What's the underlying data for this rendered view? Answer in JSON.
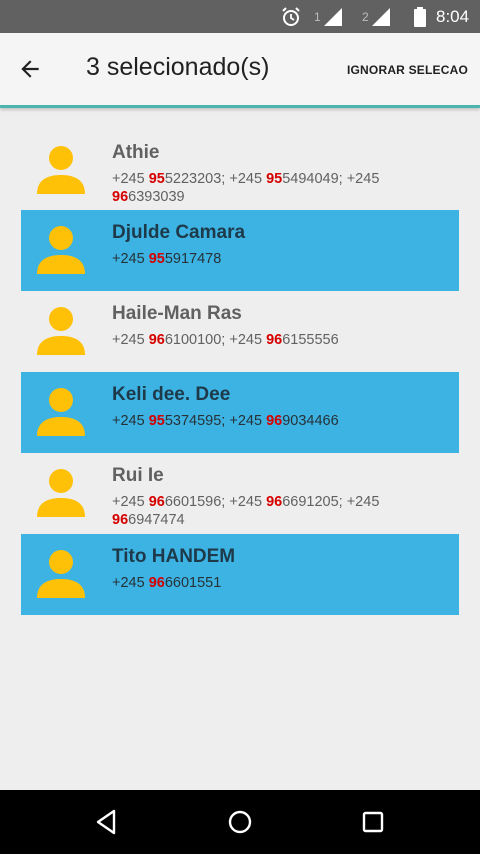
{
  "status_bar": {
    "time": "8:04",
    "sim1_label": "1",
    "sim2_label": "2",
    "icons": [
      "alarm-icon",
      "signal-icon",
      "signal-icon",
      "battery-icon"
    ]
  },
  "toolbar": {
    "title": "3 selecionado(s)",
    "action_label": "IGNORAR SELECAO",
    "back_icon": "arrow-back-icon",
    "accent_color": "#4DB6AC"
  },
  "colors": {
    "selected_row": "#3DB3E3",
    "avatar": "#FFC107",
    "prefix_highlight": "#D50000"
  },
  "contacts": [
    {
      "name": "Athie",
      "selected": false,
      "phones": [
        {
          "country": "+245",
          "prefix": "95",
          "rest": "5223203"
        },
        {
          "country": "+245",
          "prefix": "95",
          "rest": "5494049"
        },
        {
          "country": "+245",
          "prefix": "96",
          "rest": "6393039"
        }
      ]
    },
    {
      "name": "Djulde Camara",
      "selected": true,
      "phones": [
        {
          "country": "+245",
          "prefix": "95",
          "rest": "5917478"
        }
      ]
    },
    {
      "name": "Haile-Man Ras",
      "selected": false,
      "phones": [
        {
          "country": "+245",
          "prefix": "96",
          "rest": "6100100"
        },
        {
          "country": "+245",
          "prefix": "96",
          "rest": "6155556"
        }
      ]
    },
    {
      "name": "Keli dee. Dee",
      "selected": true,
      "phones": [
        {
          "country": "+245",
          "prefix": "95",
          "rest": "5374595"
        },
        {
          "country": "+245",
          "prefix": "96",
          "rest": "9034466"
        }
      ]
    },
    {
      "name": "Rui Ie",
      "selected": false,
      "phones": [
        {
          "country": "+245",
          "prefix": "96",
          "rest": "6601596"
        },
        {
          "country": "+245",
          "prefix": "96",
          "rest": "6691205"
        },
        {
          "country": "+245",
          "prefix": "96",
          "rest": "6947474"
        }
      ]
    },
    {
      "name": "Tito HANDEM",
      "selected": true,
      "phones": [
        {
          "country": "+245",
          "prefix": "96",
          "rest": "6601551"
        }
      ]
    }
  ],
  "nav_bar": {
    "icons": [
      "back-triangle-icon",
      "home-circle-icon",
      "recents-square-icon"
    ]
  }
}
